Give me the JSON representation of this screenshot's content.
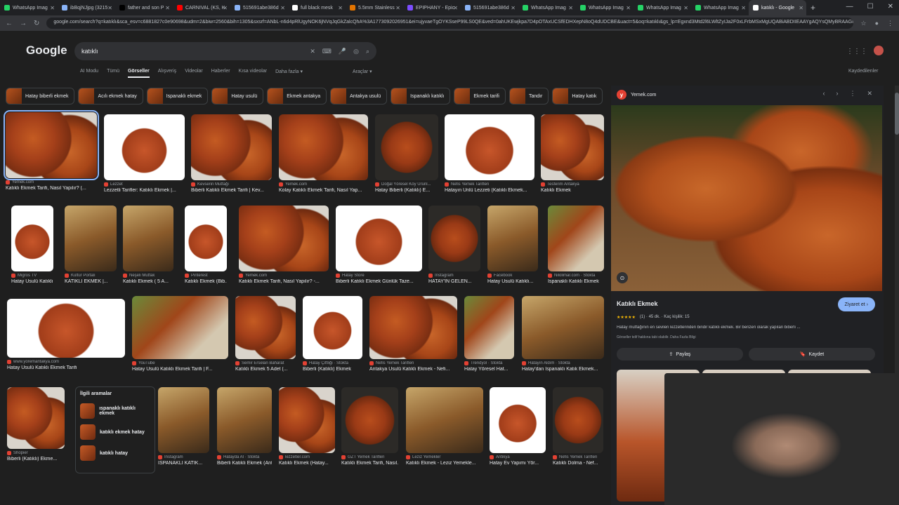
{
  "browser": {
    "tabs": [
      {
        "label": "WhatsApp Imag",
        "color": "#25d366"
      },
      {
        "label": "ibBqjNJjpg (3215",
        "color": "#8ab4f8"
      },
      {
        "label": "father and son P",
        "color": "#000000"
      },
      {
        "label": "CARNIVAL (KS, K",
        "color": "#ff0000"
      },
      {
        "label": "515691abe386d",
        "color": "#8ab4f8"
      },
      {
        "label": "full black mesk",
        "color": "#ffffff"
      },
      {
        "label": "5.5mm Stainless",
        "color": "#e37400"
      },
      {
        "label": "EPIPHANY - Epic",
        "color": "#7c4dff"
      },
      {
        "label": "515691abe386d",
        "color": "#8ab4f8"
      },
      {
        "label": "WhatsApp Imag",
        "color": "#25d366"
      },
      {
        "label": "WhatsApp Imag",
        "color": "#25d366"
      },
      {
        "label": "WhatsApp Imag",
        "color": "#25d366"
      },
      {
        "label": "WhatsApp Imag",
        "color": "#25d366"
      },
      {
        "label": "katıklı - Google",
        "color": "#ffffff",
        "active": true
      }
    ],
    "url": "google.com/search?q=katıklı&sca_esv=c6881827c0e90698&udm=2&biw=2560&bih=1305&sxsrf=ANbL-n6d4pRlUgyNOK6jNVqJqGkZalcQhA%3A1773092026951&ei=ujyvaeTgOYKSseP99LS0QE&ved=0ahUKEwjkpa7D4pOTAxUCSfEDHXepN8oQ4dUDCBE&uact=5&oq=katıklı&gs_lp=Egxnd3Mtd2l6LWltZyIJa2F0xLFrbMSxMgUQABiABDIIEAAYgAQYsQMyBRAAGIA"
  },
  "google": {
    "logo": "Google",
    "query": "katıklı",
    "nav_tabs": [
      "AI Modu",
      "Tümü",
      "Görseller",
      "Alışveriş",
      "Videolar",
      "Haberler",
      "Kısa videolar",
      "Daha fazla ▾"
    ],
    "selected_tab": "Görseller",
    "tools": "Araçlar ▾",
    "saved": "Kaydedilenler"
  },
  "chips": [
    "Hatay biberli ekmek",
    "Acılı ekmek hatay",
    "Ispanaklı ekmek",
    "Hatay usulü",
    "Ekmek antakya",
    "Antakya usulü",
    "Ispanaklı katıklı",
    "Ekmek tarifi",
    "Tandır",
    "Hatay katık"
  ],
  "results": [
    {
      "src": "Yemek.com",
      "title": "Katıklı Ekmek Tarifi, Nasıl Yapılır? (...",
      "style": "pic"
    },
    {
      "src": "Lezzet",
      "title": "Lezzetli Tarifler: Katıklı Ekmek |...",
      "style": "pic4"
    },
    {
      "src": "Kevserin Mutfağı",
      "title": "Biberli Katıklı Ekmek Tarifi | Kev...",
      "style": "pic"
    },
    {
      "src": "Yemek.com",
      "title": "Kolay Katıklı Ekmek Tarifi, Nasıl Yap...",
      "style": "pic"
    },
    {
      "src": "Doğal Yöresel Köy Ürünl...",
      "title": "Hatay Biberli (Katıklı) E...",
      "style": "pic2"
    },
    {
      "src": "Nefis Yemek Tarifleri",
      "title": "Hatayın Ünlü Lezzeti (Katıklı Ekmek...",
      "style": "pic4"
    },
    {
      "src": "Tesferim Antakya",
      "title": "Katıklı Ekmek",
      "style": "pic"
    },
    {
      "src": "Migros TV",
      "title": "Hatay Usulü Katıklı...",
      "style": "pic4"
    },
    {
      "src": "Kültür Portalı",
      "title": "KATIKLI EKMEK |...",
      "style": "pic3"
    },
    {
      "src": "Neşeli Mutfak",
      "title": "Katıklı Ekmek ( 5 A...",
      "style": "pic3"
    },
    {
      "src": "Pinterest",
      "title": "Katıklı Ekmek (Bib...",
      "style": "pic4"
    },
    {
      "src": "Yemek.com",
      "title": "Katıklı Ekmek Tarifi, Nasıl Yapılır? -...",
      "style": "pic"
    },
    {
      "src": "Hatay Store",
      "title": "Biberli Katıklı Ekmek Günlük Taze...",
      "style": "pic4"
    },
    {
      "src": "Instagram",
      "title": "HATAY'IN GELEN...",
      "style": "pic2"
    },
    {
      "src": "Facebook",
      "title": "Hatay Usulü Katıklı...",
      "style": "pic3"
    },
    {
      "src": "Nilolimar.com · Stokta",
      "title": "Ispanaklı Katıklı Ekmek",
      "style": "pic5"
    },
    {
      "src": "www.yoremantakya.com",
      "title": "Hatay Usulü Katıklı Ekmek Tarifi",
      "style": "pic4"
    },
    {
      "src": "YouTube",
      "title": "Hatay Usulü Katıklı Ekmek Tarifi | F...",
      "style": "pic5"
    },
    {
      "src": "Semir Erselan Baharat",
      "title": "Katıklı Ekmek 5 Adet (...",
      "style": "pic"
    },
    {
      "src": "Hatay Çiftliği · Stokta",
      "title": "Biberli (Katıklı) Ekmek",
      "style": "pic4"
    },
    {
      "src": "Nefis Yemek Tarifleri",
      "title": "Antakya Usulü Katıklı Ekmek - Nefi...",
      "style": "pic"
    },
    {
      "src": "Trendyol · Stokta",
      "title": "Hatay Yöresel Hat...",
      "style": "pic5"
    },
    {
      "src": "Hatayın Aldım · Stokta",
      "title": "Hatay'dan Ispanaklı Katık Ekmek...",
      "style": "pic3"
    },
    {
      "src": "Shopier",
      "title": "Biberli (Katıklı) Ekme...",
      "style": "pic"
    },
    {
      "src": "Instagram",
      "title": "ISPANAKLI KATIK...",
      "style": "pic3"
    },
    {
      "src": "Hatayda Al · Stokta",
      "title": "Biberli Katıklı Ekmek (Antak...",
      "style": "pic3"
    },
    {
      "src": "lezzetler.com",
      "title": "Katıklı Ekmek (Hatay...",
      "style": "pic"
    },
    {
      "src": "GZT Yemek Tarifleri",
      "title": "Katıklı Ekmek Tarifi, Nasıl...",
      "style": "pic2"
    },
    {
      "src": "Leziz Yemekler",
      "title": "Katıklı Ekmek - Leziz Yemekle...",
      "style": "pic3"
    },
    {
      "src": "Antikya",
      "title": "Hatay Ev Yapımı Yör...",
      "style": "pic4"
    },
    {
      "src": "Nefis Yemek Tarifleri",
      "title": "Katıklı Dolma - Nef...",
      "style": "pic2"
    }
  ],
  "related": {
    "heading": "İlgili aramalar",
    "items": [
      "ıspanaklı katıklı ekmek",
      "katıklı ekmek hatay",
      "katıklı hatay"
    ]
  },
  "panel": {
    "source": "Yemek.com",
    "favicon": "y",
    "title": "Katıklı Ekmek",
    "visit": "Ziyaret et ›",
    "stars": "★★★★★",
    "rating_text": "(1) · 45 dk. · Kaç kişilik: 15",
    "description": "Hatay mutfağının en sevilen lezzetlerinden biridir katıklı ekmek. Bir benzeri olarak yapılan biberli ...",
    "note": "Görseller telif hakkına tabi olabilir. Daha Fazla Bilgi",
    "share": "Paylaş",
    "save": "Kaydet"
  }
}
